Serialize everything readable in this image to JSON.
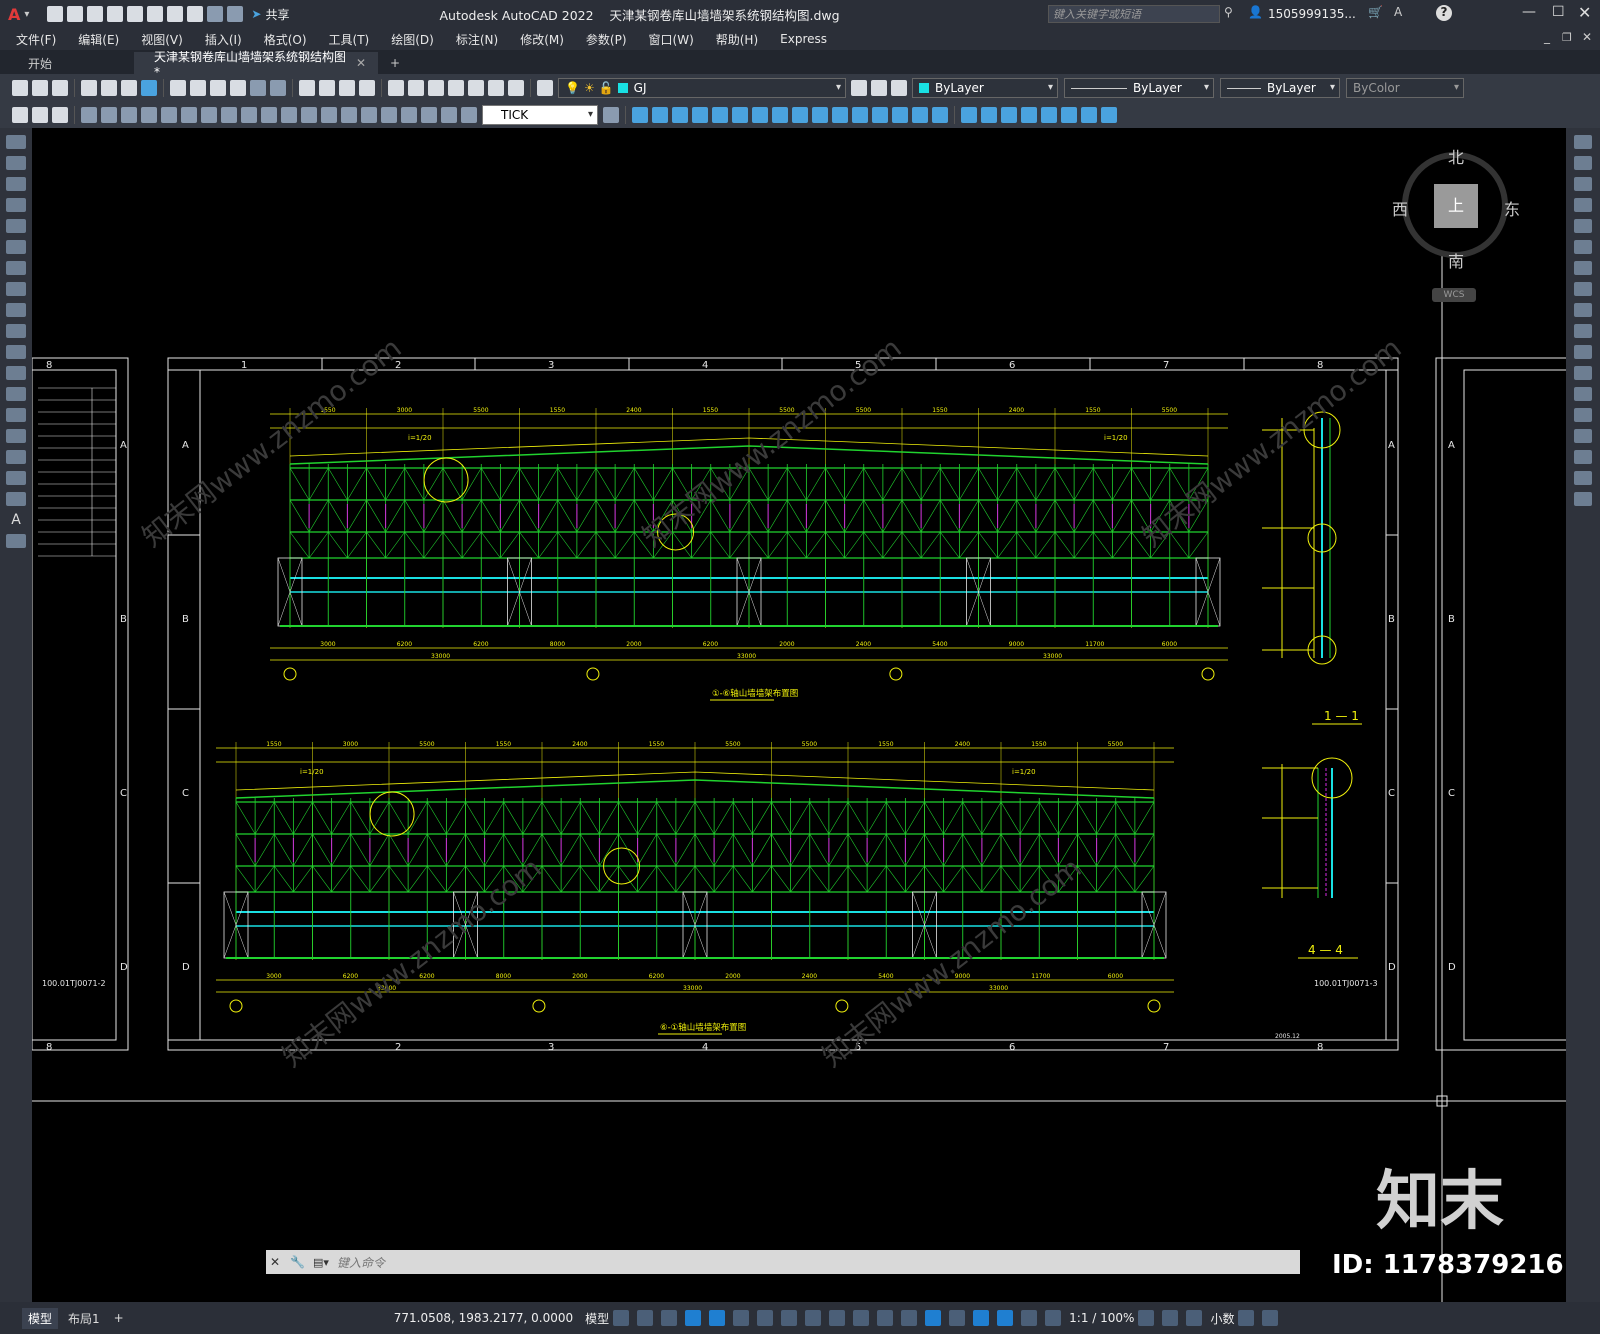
{
  "app": {
    "title": "Autodesk AutoCAD 2022",
    "filename": "天津某钢卷库山墙墙架系统钢结构图.dwg",
    "search_placeholder": "键入关键字或短语",
    "user": "1505999135...",
    "share": "共享"
  },
  "menu": [
    "文件(F)",
    "编辑(E)",
    "视图(V)",
    "插入(I)",
    "格式(O)",
    "工具(T)",
    "绘图(D)",
    "标注(N)",
    "修改(M)",
    "参数(P)",
    "窗口(W)",
    "帮助(H)",
    "Express"
  ],
  "tabs": [
    {
      "label": "开始"
    },
    {
      "label": "天津某钢卷库山墙墙架系统钢结构图*"
    }
  ],
  "toolbar": {
    "layer": "GJ",
    "color": "ByLayer",
    "linetype": "ByLayer",
    "lineweight": "ByLayer",
    "plotstyle": "ByColor",
    "dimstyle": "TICK"
  },
  "viewcube": {
    "north": "北",
    "south": "南",
    "east": "东",
    "west": "西",
    "top": "上",
    "wcs": "WCS"
  },
  "drawing": {
    "columns": [
      "1",
      "2",
      "3",
      "4",
      "5",
      "6",
      "7",
      "8"
    ],
    "left_col": "8",
    "rows": [
      "A",
      "B",
      "C",
      "D"
    ],
    "top_title": "①-⑥轴山墙墙架布置图",
    "bottom_title": "⑥-①轴山墙墙架布置图",
    "section1": "1 — 1",
    "section4": "4 — 4",
    "code_left": "100.01TJ0071-2",
    "code_right": "100.01TJ0071-3",
    "date": "2005.12",
    "slope_a": "i=1/20",
    "slope_b": "i=1/20",
    "dims_top": [
      "1550",
      "3000",
      "5500",
      "1550",
      "2400",
      "1550",
      "5500",
      "5500",
      "1550",
      "2400",
      "1550",
      "5500"
    ],
    "totals": [
      "33000",
      "33000",
      "33000"
    ],
    "bottom_dims": [
      "3000",
      "6200",
      "6200",
      "8000",
      "2000",
      "6200",
      "2000",
      "2400",
      "5400",
      "9000",
      "11700",
      "6000"
    ]
  },
  "watermark": {
    "logo": "知末",
    "id": "ID: 1178379216",
    "text": "知末网www.znzmo.com"
  },
  "command": {
    "placeholder": "键入命令"
  },
  "status": {
    "layout_tabs": [
      "模型",
      "布局1"
    ],
    "coords": "771.0508, 1983.2177, 0.0000",
    "space": "模型",
    "scale": "1:1 / 100%",
    "units": "小数"
  },
  "colors": {
    "frame_green": "#21d32f",
    "frame_yellow": "#f1f10c",
    "accent_cyan": "#19e0e3",
    "magenta": "#d52adf",
    "white_line": "#e6e6e6"
  }
}
